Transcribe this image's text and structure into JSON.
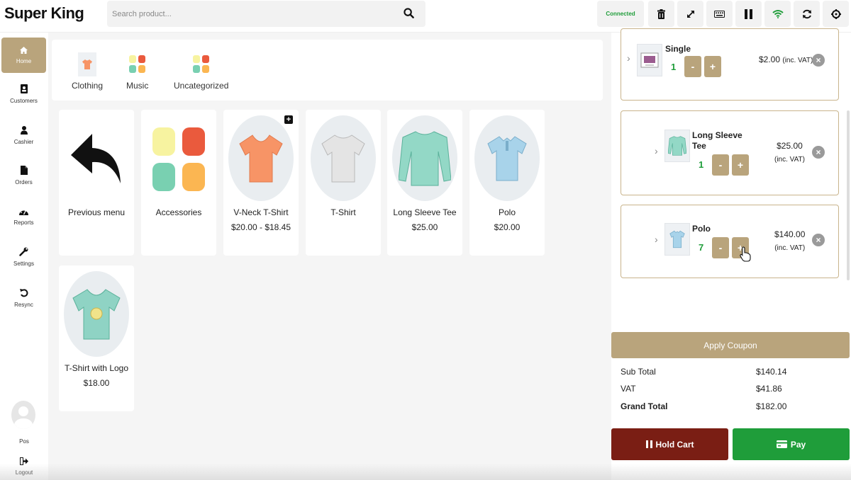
{
  "app": {
    "title": "Super King"
  },
  "search": {
    "placeholder": "Search product..."
  },
  "toolbar": {
    "status": "Connected",
    "icons": [
      "trash-icon",
      "expand-icon",
      "keyboard-icon",
      "pause-icon",
      "wifi-icon",
      "refresh-icon",
      "settings-icon"
    ]
  },
  "sidebar": {
    "items": [
      {
        "label": "Home",
        "icon": "home-icon",
        "active": true
      },
      {
        "label": "Customers",
        "icon": "contacts-icon"
      },
      {
        "label": "Cashier",
        "icon": "user-icon"
      },
      {
        "label": "Orders",
        "icon": "document-icon"
      },
      {
        "label": "Reports",
        "icon": "dashboard-icon"
      },
      {
        "label": "Settings",
        "icon": "wrench-icon"
      },
      {
        "label": "Resync",
        "icon": "resync-icon"
      }
    ],
    "user": "Pos",
    "logout": "Logout"
  },
  "categories": [
    {
      "label": "Clothing"
    },
    {
      "label": "Music"
    },
    {
      "label": "Uncategorized"
    }
  ],
  "products": [
    {
      "name": "Previous menu",
      "price": ""
    },
    {
      "name": "Accessories",
      "price": ""
    },
    {
      "name": "V-Neck T-Shirt",
      "price": "$20.00 - $18.45"
    },
    {
      "name": "T-Shirt",
      "price": ""
    },
    {
      "name": "Long Sleeve Tee",
      "price": "$25.00"
    },
    {
      "name": "Polo",
      "price": "$20.00"
    },
    {
      "name": "T-Shirt with Logo",
      "price": "$18.00"
    }
  ],
  "cart": {
    "items": [
      {
        "name": "Single",
        "qty": "1",
        "price": "$2.00",
        "vat_note": "(inc. VAT)"
      },
      {
        "name_line1": "Long Sleeve",
        "name_line2": "Tee",
        "qty": "1",
        "price": "$25.00",
        "vat_note": "(inc. VAT)"
      },
      {
        "name": "Polo",
        "qty": "7",
        "price": "$140.00",
        "vat_note": "(inc. VAT)"
      }
    ],
    "minus": "-",
    "plus": "+",
    "apply_coupon": "Apply Coupon",
    "totals": [
      {
        "label": "Sub Total",
        "value": "$140.14"
      },
      {
        "label": "VAT",
        "value": "$41.86"
      },
      {
        "label": "Grand Total",
        "value": "$182.00"
      }
    ],
    "hold_label": "Hold Cart",
    "pay_label": "Pay"
  },
  "colors": {
    "accent": "#b9a47c",
    "hold": "#7a1e14",
    "pay": "#1f9d3a",
    "status": "#1f9d3a"
  }
}
